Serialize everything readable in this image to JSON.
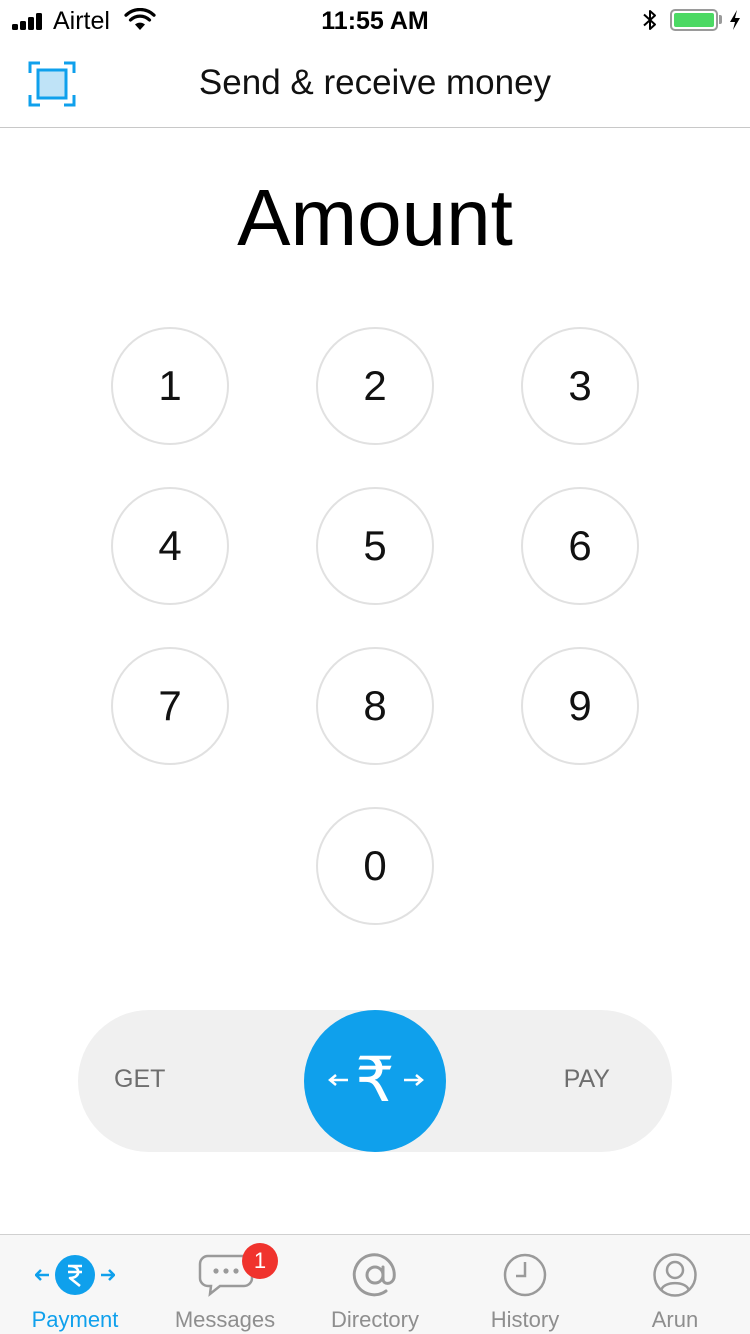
{
  "status_bar": {
    "carrier": "Airtel",
    "time": "11:55 AM",
    "battery_level": 1.0
  },
  "header": {
    "title": "Send & receive money",
    "scan_icon": "scan-frame-icon"
  },
  "amount": {
    "placeholder": "Amount"
  },
  "keypad": {
    "keys": [
      "1",
      "2",
      "3",
      "4",
      "5",
      "6",
      "7",
      "8",
      "9",
      "0"
    ]
  },
  "slider": {
    "left_label": "GET",
    "right_label": "PAY",
    "knob_symbol": "₹",
    "knob_icon": "rupee-exchange-icon"
  },
  "tabbar": {
    "tabs": [
      {
        "label": "Payment",
        "icon": "rupee-exchange-icon",
        "active": true
      },
      {
        "label": "Messages",
        "icon": "message-bubble-icon",
        "active": false,
        "badge": "1"
      },
      {
        "label": "Directory",
        "icon": "at-sign-icon",
        "active": false
      },
      {
        "label": "History",
        "icon": "clock-icon",
        "active": false
      },
      {
        "label": "Arun",
        "icon": "profile-icon",
        "active": false
      }
    ]
  },
  "colors": {
    "accent": "#0fa0ec",
    "badge": "#f0332d",
    "battery": "#4cd964",
    "slider_track": "#f0f0f0"
  }
}
